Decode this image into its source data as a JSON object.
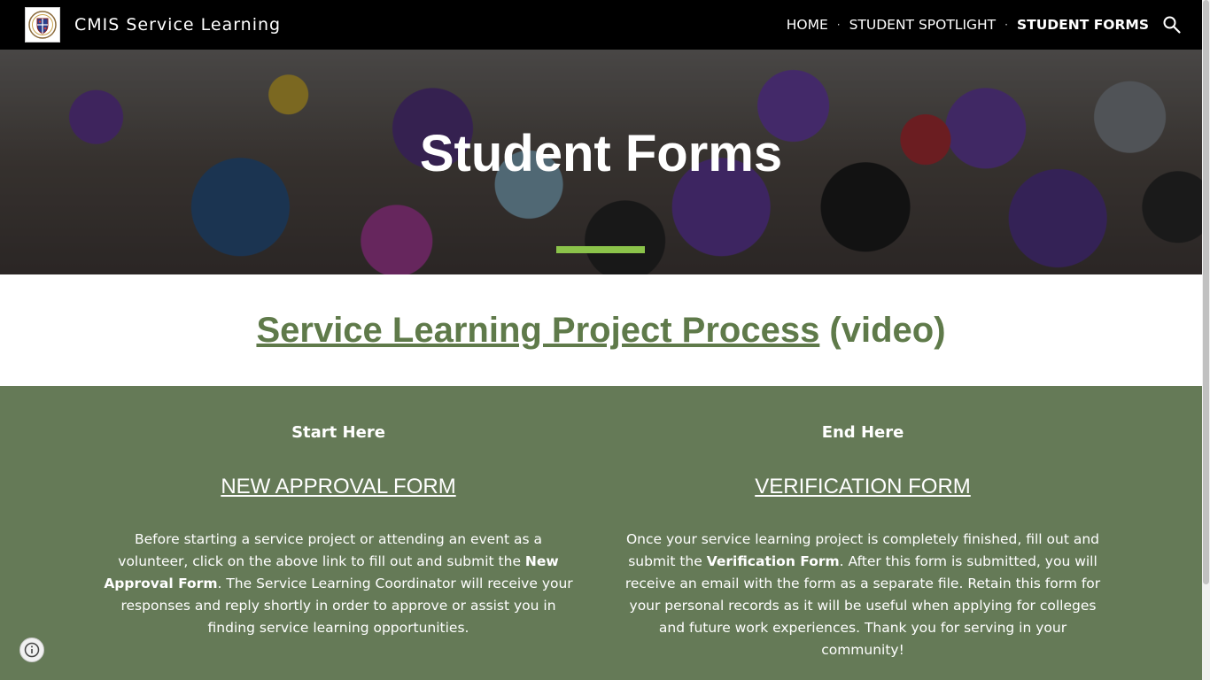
{
  "header": {
    "site_title": "CMIS Service Learning",
    "nav": [
      {
        "label": "HOME",
        "active": false
      },
      {
        "label": "STUDENT SPOTLIGHT",
        "active": false
      },
      {
        "label": "STUDENT FORMS",
        "active": true
      }
    ],
    "separator": "·",
    "search_icon": "search-icon",
    "logo_icon": "school-crest-logo"
  },
  "hero": {
    "title": "Student Forms",
    "accent_color": "#8bc34a"
  },
  "video_section": {
    "link_text": "Service Learning Project Process",
    "suffix": " (video)",
    "link_color": "#5f7a4a"
  },
  "forms": {
    "background_color": "#657a57",
    "left": {
      "heading": "Start Here",
      "link": "NEW APPROVAL FORM",
      "text_before": "Before starting a service project or attending an event as a volunteer, click on the above link to fill out and submit the ",
      "text_bold": "New Approval Form",
      "text_after": ". The Service Learning Coordinator will receive your responses and reply shortly in order to approve or assist you in finding service learning opportunities."
    },
    "right": {
      "heading": "End Here",
      "link": "VERIFICATION FORM",
      "text_before": "Once your service learning project is completely finished, fill out and submit the ",
      "text_bold": "Verification Form",
      "text_after": ". After this form is submitted, you will receive an email with the form as a separate file. Retain this form for your personal records as it will be useful when applying for colleges and future work experiences. Thank you for serving in your community!"
    }
  },
  "footer": {
    "info_icon": "info-icon"
  }
}
